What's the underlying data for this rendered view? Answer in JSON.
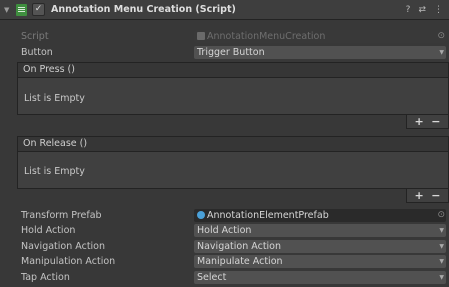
{
  "component": {
    "title": "Annotation Menu Creation (Script)",
    "enabled": true,
    "check_glyph": "✓",
    "foldout_glyph": "▼",
    "header_icons": [
      "help-icon",
      "presets-icon",
      "more-options-icon"
    ],
    "header_glyphs": {
      "help": "?",
      "presets": "⇄",
      "more": "⋮"
    }
  },
  "script_field": {
    "label": "Script",
    "value": "AnnotationMenuCreation"
  },
  "button_field": {
    "label": "Button",
    "value": "Trigger Button"
  },
  "events": {
    "on_press": {
      "label": "On Press ()",
      "empty_text": "List is Empty",
      "add": "+",
      "remove": "−"
    },
    "on_release": {
      "label": "On Release ()",
      "empty_text": "List is Empty",
      "add": "+",
      "remove": "−"
    }
  },
  "fields": {
    "transform_prefab": {
      "label": "Transform Prefab",
      "value": "AnnotationElementPrefab"
    },
    "hold_action": {
      "label": "Hold Action",
      "value": "Hold Action"
    },
    "navigation_action": {
      "label": "Navigation Action",
      "value": "Navigation Action"
    },
    "manipulation_action": {
      "label": "Manipulation Action",
      "value": "Manipulate Action"
    },
    "tap_action": {
      "label": "Tap Action",
      "value": "Select"
    }
  },
  "glyphs": {
    "dropdown": "▼",
    "picker": "⊙"
  },
  "colors": {
    "background": "#383838",
    "field": "#515151",
    "object_field": "#2a2a2a",
    "script_icon": "#3f8f3f",
    "prefab_icon": "#4aa0d8"
  }
}
